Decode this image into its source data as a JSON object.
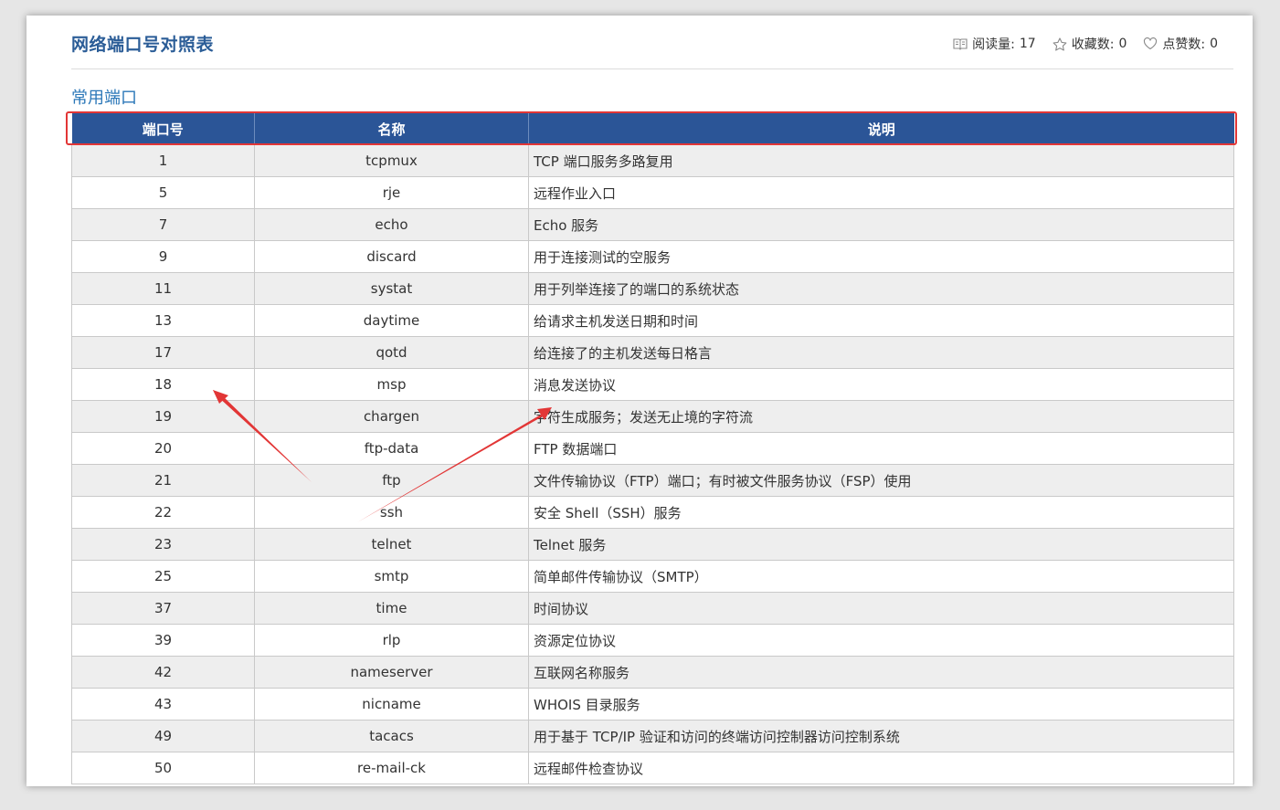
{
  "header": {
    "title": "网络端口号对照表",
    "reads_label": "阅读量:",
    "reads_value": "17",
    "favorites_label": "收藏数:",
    "favorites_value": "0",
    "likes_label": "点赞数:",
    "likes_value": "0"
  },
  "section_title": "常用端口",
  "table": {
    "columns": [
      "端口号",
      "名称",
      "说明"
    ],
    "rows": [
      {
        "port": "1",
        "name": "tcpmux",
        "desc": "TCP 端口服务多路复用"
      },
      {
        "port": "5",
        "name": "rje",
        "desc": "远程作业入口"
      },
      {
        "port": "7",
        "name": "echo",
        "desc": "Echo 服务"
      },
      {
        "port": "9",
        "name": "discard",
        "desc": "用于连接测试的空服务"
      },
      {
        "port": "11",
        "name": "systat",
        "desc": "用于列举连接了的端口的系统状态"
      },
      {
        "port": "13",
        "name": "daytime",
        "desc": "给请求主机发送日期和时间"
      },
      {
        "port": "17",
        "name": "qotd",
        "desc": "给连接了的主机发送每日格言"
      },
      {
        "port": "18",
        "name": "msp",
        "desc": "消息发送协议"
      },
      {
        "port": "19",
        "name": "chargen",
        "desc": "字符生成服务；发送无止境的字符流"
      },
      {
        "port": "20",
        "name": "ftp-data",
        "desc": "FTP 数据端口"
      },
      {
        "port": "21",
        "name": "ftp",
        "desc": "文件传输协议（FTP）端口；有时被文件服务协议（FSP）使用"
      },
      {
        "port": "22",
        "name": "ssh",
        "desc": "安全 Shell（SSH）服务"
      },
      {
        "port": "23",
        "name": "telnet",
        "desc": "Telnet 服务"
      },
      {
        "port": "25",
        "name": "smtp",
        "desc": "简单邮件传输协议（SMTP）"
      },
      {
        "port": "37",
        "name": "time",
        "desc": "时间协议"
      },
      {
        "port": "39",
        "name": "rlp",
        "desc": "资源定位协议"
      },
      {
        "port": "42",
        "name": "nameserver",
        "desc": "互联网名称服务"
      },
      {
        "port": "43",
        "name": "nicname",
        "desc": "WHOIS 目录服务"
      },
      {
        "port": "49",
        "name": "tacacs",
        "desc": "用于基于 TCP/IP 验证和访问的终端访问控制器访问控制系统"
      },
      {
        "port": "50",
        "name": "re-mail-ck",
        "desc": "远程邮件检查协议"
      }
    ]
  },
  "colors": {
    "title": "#2b5d97",
    "section": "#2b77b8",
    "header_bg": "#2b5597",
    "row_alt": "#eeeeee",
    "annotation": "#e23636"
  },
  "icons": {
    "reads": "book-icon",
    "favorites": "star-icon",
    "likes": "heart-icon"
  }
}
